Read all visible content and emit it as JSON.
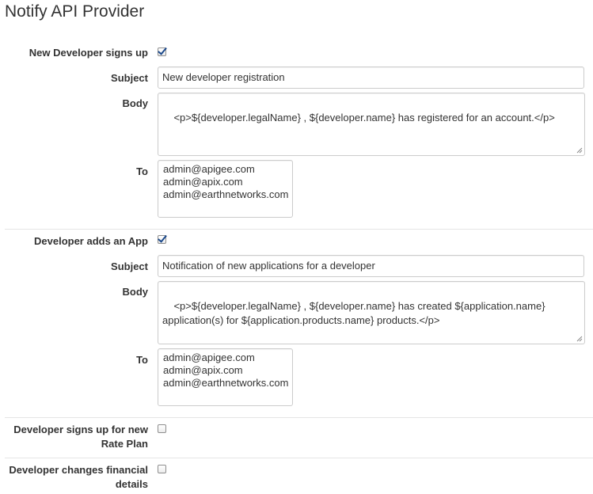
{
  "page": {
    "title": "Notify API Provider"
  },
  "notifications": [
    {
      "label": "New Developer signs up",
      "checked": true,
      "subject_label": "Subject",
      "subject": "New developer registration",
      "body_label": "Body",
      "body": "<p>${developer.legalName} , ${developer.name} has registered for an account.</p>",
      "to_label": "To",
      "to": [
        "admin@apigee.com",
        "admin@apix.com",
        "admin@earthnetworks.com"
      ]
    },
    {
      "label": "Developer adds an App",
      "checked": true,
      "subject_label": "Subject",
      "subject": "Notification of new applications for a developer",
      "body_label": "Body",
      "body": "<p>${developer.legalName} , ${developer.name} has created ${application.name} application(s) for ${application.products.name} products.</p>",
      "to_label": "To",
      "to": [
        "admin@apigee.com",
        "admin@apix.com",
        "admin@earthnetworks.com"
      ]
    },
    {
      "label": "Developer signs up for new Rate Plan",
      "checked": false
    },
    {
      "label": "Developer changes financial details",
      "checked": false
    }
  ],
  "colors": {
    "check": "#1d4a8c",
    "border": "#cccccc",
    "divider": "#e5e5e5",
    "text": "#333333"
  }
}
